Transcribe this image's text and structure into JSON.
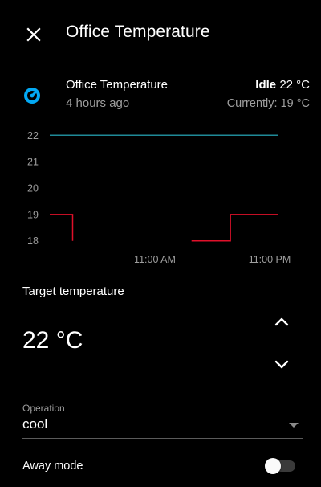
{
  "dialog": {
    "title": "Office Temperature",
    "close_icon": "close-icon"
  },
  "entity": {
    "icon": "thermostat-icon",
    "name": "Office Temperature",
    "last_changed": "4 hours ago",
    "state": "Idle",
    "target": "22 °C",
    "current": "Currently: 19 °C"
  },
  "colors": {
    "background": "#000000",
    "accent": "#03a9f4",
    "target_line": "#1f8a98",
    "current_line": "#e0102a",
    "secondary_text": "#9e9e9e"
  },
  "chart_data": {
    "type": "line",
    "y_ticks": [
      "22",
      "21",
      "20",
      "19",
      "18"
    ],
    "x_ticks": [
      "11:00 AM",
      "11:00 PM"
    ],
    "ylim": [
      17.9,
      22.1
    ],
    "xlim": [
      0,
      100
    ],
    "grid": false,
    "series": [
      {
        "x": [
          0,
          100
        ],
        "values": [
          22,
          22
        ]
      },
      {
        "x": [
          0,
          10,
          10
        ],
        "values": [
          19,
          19,
          18
        ]
      },
      {
        "x": [
          62,
          79,
          79,
          100
        ],
        "values": [
          18,
          18,
          19,
          19
        ]
      }
    ]
  },
  "target_temperature": {
    "label": "Target temperature",
    "value": "22 °C",
    "up_icon": "chevron-up-icon",
    "down_icon": "chevron-down-icon"
  },
  "operation": {
    "label": "Operation",
    "value": "cool"
  },
  "away_mode": {
    "label": "Away mode",
    "enabled": false
  }
}
